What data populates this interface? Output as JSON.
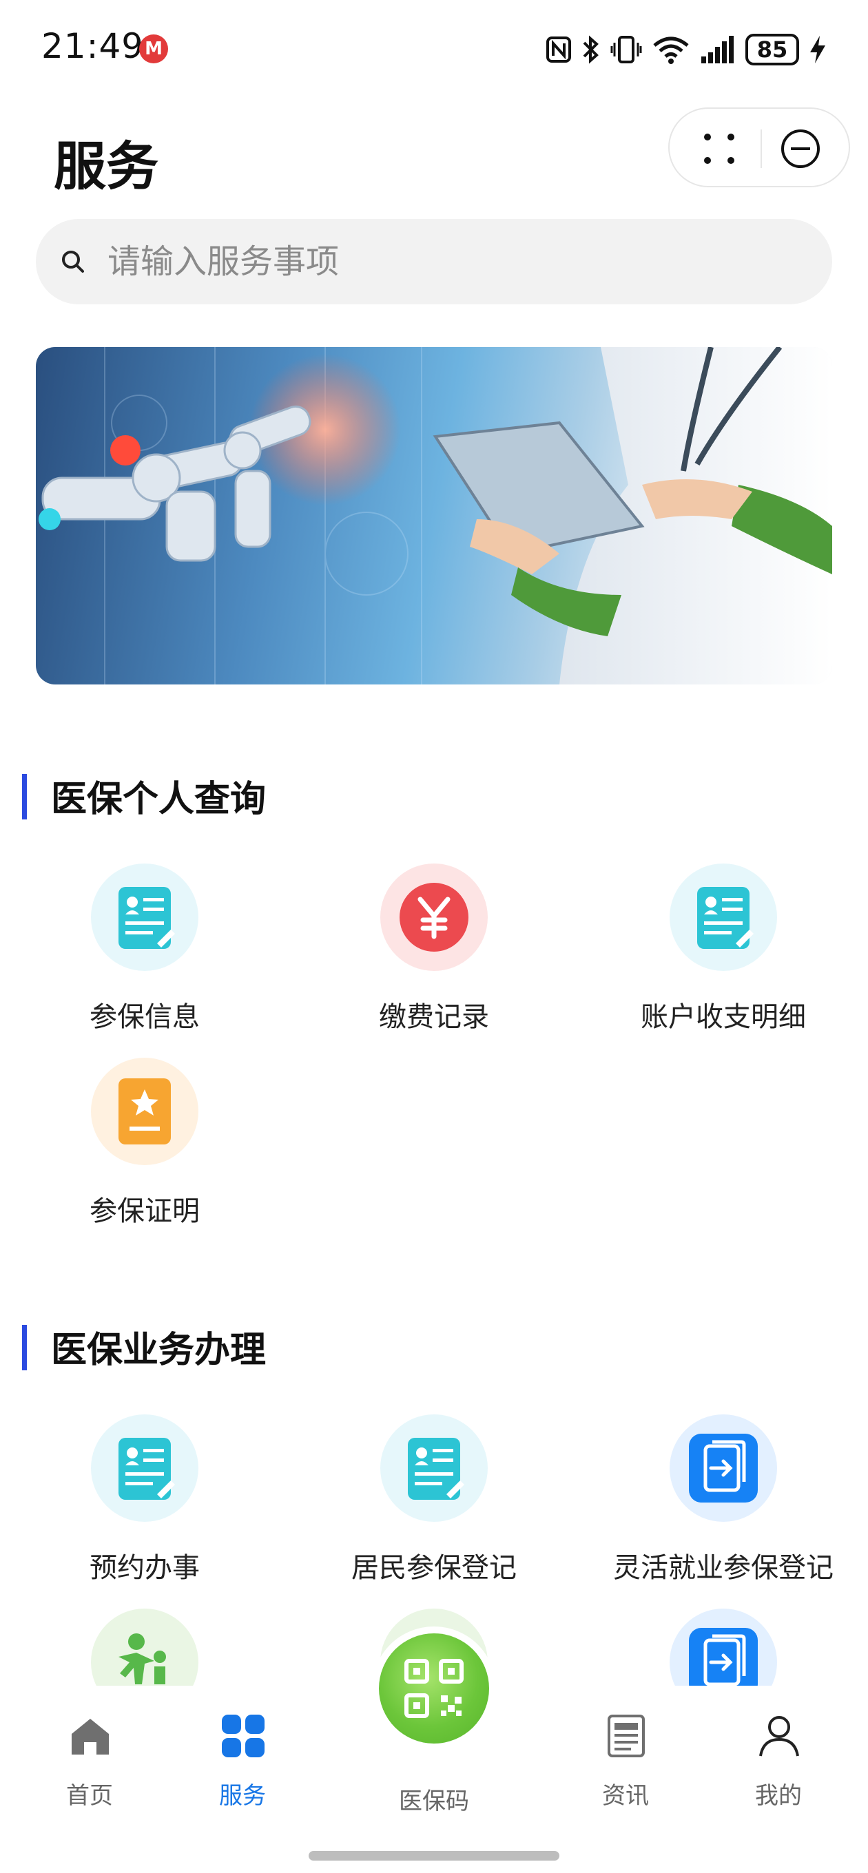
{
  "status_bar": {
    "time": "21:49",
    "metro_badge": "M",
    "battery": "85",
    "icons": [
      "nfc-icon",
      "bluetooth-icon",
      "vibrate-icon",
      "wifi-icon",
      "signal-icon",
      "battery-icon",
      "charging-icon"
    ]
  },
  "header": {
    "title": "服务",
    "capsule": {
      "more_icon": "more-dots-icon",
      "close_icon": "close-circle-icon"
    }
  },
  "search": {
    "placeholder": "请输入服务事项",
    "value": ""
  },
  "sections": [
    {
      "title": "医保个人查询",
      "items": [
        {
          "label": "参保信息",
          "icon": "profile-card-icon"
        },
        {
          "label": "缴费记录",
          "icon": "yuan-icon"
        },
        {
          "label": "账户收支明细",
          "icon": "profile-card-icon"
        },
        {
          "label": "参保证明",
          "icon": "certificate-icon"
        }
      ]
    },
    {
      "title": "医保业务办理",
      "items": [
        {
          "label": "预约办事",
          "icon": "profile-card-icon"
        },
        {
          "label": "居民参保登记",
          "icon": "profile-card-icon"
        },
        {
          "label": "灵活就业参保登记",
          "icon": "transfer-icon"
        },
        {
          "label": "",
          "icon": "family-icon"
        },
        {
          "label": "",
          "icon": "baby-icon"
        },
        {
          "label": "",
          "icon": "transfer-icon"
        }
      ]
    }
  ],
  "bottom_nav": [
    {
      "label": "首页",
      "icon": "home-icon",
      "active": false
    },
    {
      "label": "服务",
      "icon": "grid-icon",
      "active": true
    },
    {
      "label": "医保码",
      "icon": "qr-code-icon",
      "active": false
    },
    {
      "label": "资讯",
      "icon": "news-icon",
      "active": false
    },
    {
      "label": "我的",
      "icon": "person-icon",
      "active": false
    }
  ],
  "colors": {
    "accent_blue": "#1776e6",
    "section_bar": "#2b4ae0",
    "qr_green": "#6cc63a"
  }
}
